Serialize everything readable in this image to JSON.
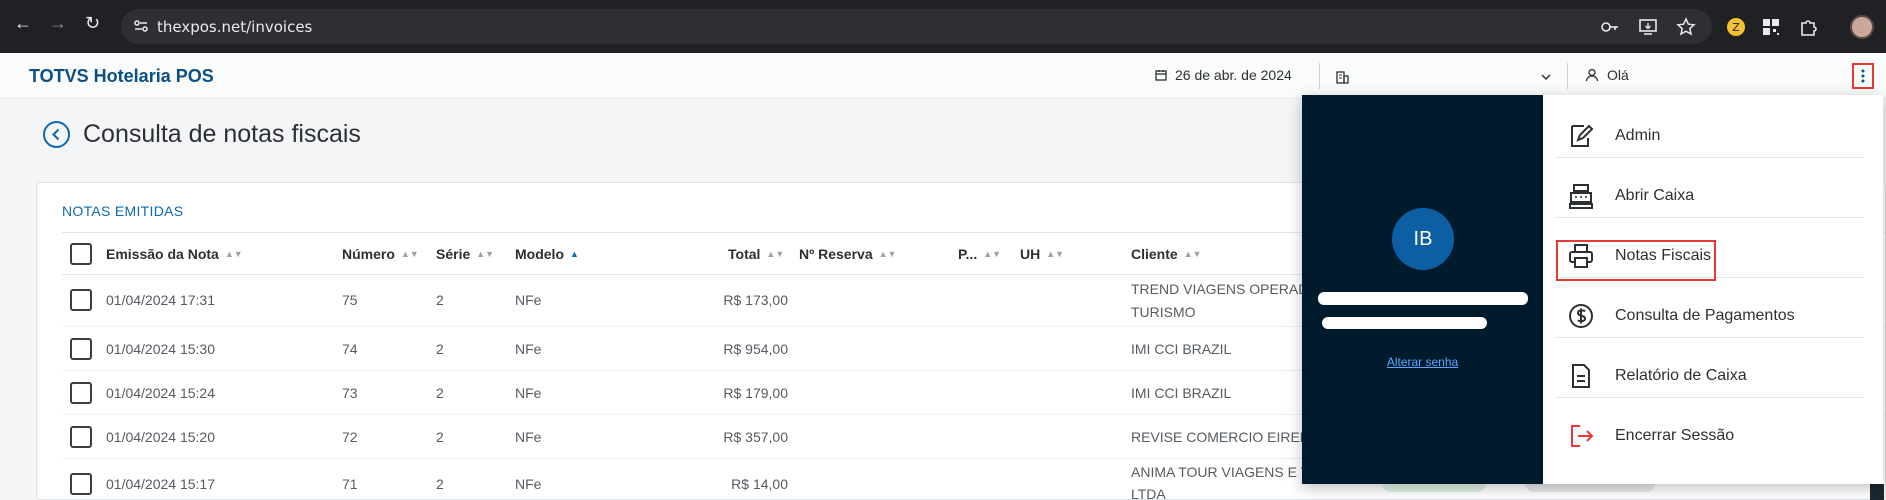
{
  "browser": {
    "url": "thexpos.net/invoices"
  },
  "header": {
    "brand": "TOTVS Hotelaria POS",
    "date": "26 de abr. de 2024",
    "hotel": "",
    "greeting": "Olá"
  },
  "page": {
    "title": "Consulta de notas fiscais"
  },
  "table": {
    "section_title": "NOTAS EMITIDAS",
    "columns": [
      "Emissão da Nota",
      "Número",
      "Série",
      "Modelo",
      "Total",
      "Nº Reserva",
      "P...",
      "UH",
      "Cliente"
    ],
    "rows": [
      {
        "date": "01/04/2024 17:31",
        "number": "75",
        "series": "2",
        "model": "NFe",
        "total": "R$ 173,00",
        "client": "TREND VIAGENS OPERAD",
        "client2": "TURISMO"
      },
      {
        "date": "01/04/2024 15:30",
        "number": "74",
        "series": "2",
        "model": "NFe",
        "total": "R$ 954,00",
        "client": "IMI CCI BRAZIL",
        "client2": ""
      },
      {
        "date": "01/04/2024 15:24",
        "number": "73",
        "series": "2",
        "model": "NFe",
        "total": "R$ 179,00",
        "client": "IMI CCI BRAZIL",
        "client2": ""
      },
      {
        "date": "01/04/2024 15:20",
        "number": "72",
        "series": "2",
        "model": "NFe",
        "total": "R$ 357,00",
        "client": "REVISE COMERCIO EIRELI",
        "client2": ""
      },
      {
        "date": "01/04/2024 15:17",
        "number": "71",
        "series": "2",
        "model": "NFe",
        "total": "R$ 14,00",
        "client": "ANIMA TOUR VIAGENS E T",
        "client2": "LTDA"
      }
    ]
  },
  "user_menu": {
    "initials": "IB",
    "change_password": "Alterar senha",
    "items": [
      {
        "label": "Admin",
        "icon": "edit-document-icon"
      },
      {
        "label": "Abrir Caixa",
        "icon": "cash-register-icon"
      },
      {
        "label": "Notas Fiscais",
        "icon": "printer-icon"
      },
      {
        "label": "Consulta de Pagamentos",
        "icon": "dollar-circle-icon"
      },
      {
        "label": "Relatório de Caixa",
        "icon": "report-document-icon"
      },
      {
        "label": "Encerrar Sessão",
        "icon": "logout-icon"
      }
    ]
  },
  "colors": {
    "brand": "#0c4f84",
    "accent": "#0c69b0",
    "profile_bg": "#001a2e",
    "highlight": "#e53935",
    "logout": "#e53935"
  }
}
